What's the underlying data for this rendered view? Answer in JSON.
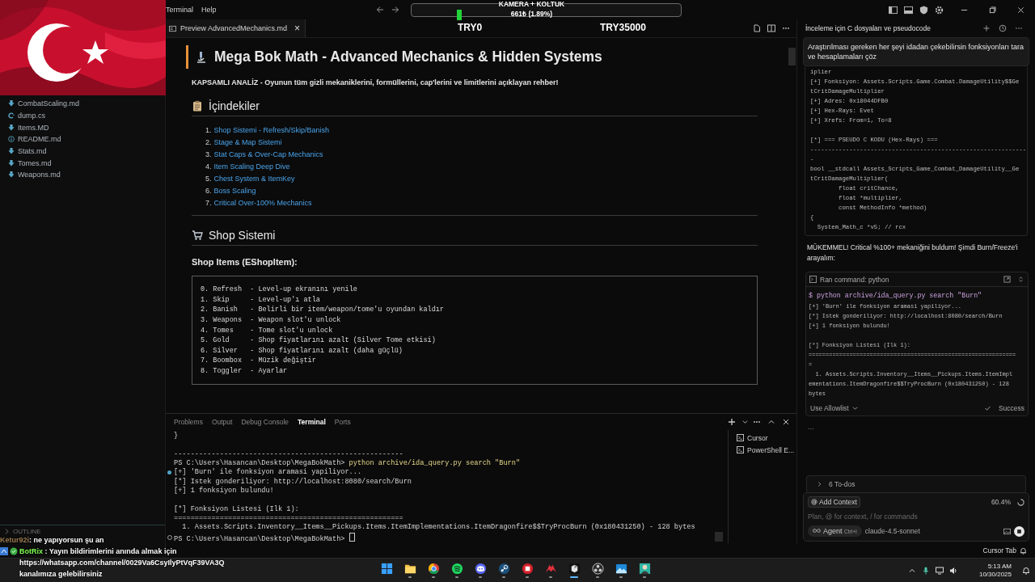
{
  "menu": [
    "Terminal",
    "Help"
  ],
  "stream_goal": {
    "title": "KAMERA + KOLTUK",
    "amount": "661₺ (1.89%)",
    "min_label": "TRY0",
    "max_label": "TRY35000"
  },
  "sidebar": {
    "files": [
      {
        "name": "CombatScaling.md",
        "kind": "markdown"
      },
      {
        "name": "dump.cs",
        "kind": "csharp"
      },
      {
        "name": "Items.MD",
        "kind": "markdown"
      },
      {
        "name": "README.md",
        "kind": "info"
      },
      {
        "name": "Stats.md",
        "kind": "markdown"
      },
      {
        "name": "Tomes.md",
        "kind": "markdown"
      },
      {
        "name": "Weapons.md",
        "kind": "markdown"
      }
    ],
    "outline_label": "OUTLINE"
  },
  "stream_chat": [
    {
      "user": "Ketur92i",
      "message": ": ne yapıyorsun şu an",
      "color": "#9a7a4e",
      "badges": false
    },
    {
      "user": "BotRix",
      "message": " : Yayın bildirimlerini anında almak için https://whatsapp.com/channel/0029Va6CsyIlyPtVqF39VA3Q kanalımıza gelebilirsiniz",
      "color": "#7dff4f",
      "badges": true
    }
  ],
  "editor_tab": {
    "label": "Preview AdvancedMechanics.md",
    "close": "×"
  },
  "doc": {
    "title": "Mega Bok Math - Advanced Mechanics & Hidden Systems",
    "intro": "KAPSAMLI ANALİZ - Oyunun tüm gizli mekaniklerini, formüllerini, cap'lerini ve limitlerini açıklayan rehber!",
    "toc_heading": "İçindekiler",
    "toc": [
      {
        "number": "1.",
        "text": "Shop Sistemi - Refresh/Skip/Banish"
      },
      {
        "number": "2.",
        "text": "Stage & Map Sistemi"
      },
      {
        "number": "3.",
        "text": "Stat Caps & Over-Cap Mechanics"
      },
      {
        "number": "4.",
        "text": "Item Scaling Deep Dive"
      },
      {
        "number": "5.",
        "text": "Chest System & ItemKey"
      },
      {
        "number": "6.",
        "text": "Boss Scaling"
      },
      {
        "number": "7.",
        "text": "Critical Over-100% Mechanics"
      }
    ],
    "shop_heading": "Shop Sistemi",
    "shop_subheading": "Shop Items (EShopItem):",
    "code": [
      "0. Refresh  - Level-up ekranını yenile",
      "1. Skip     - Level-up'ı atla",
      "2. Banish   - Belirli bir item/weapon/tome'u oyundan kaldır",
      "3. Weapons  - Weapon slot'u unlock",
      "4. Tomes    - Tome slot'u unlock",
      "5. Gold     - Shop fiyatlarını azalt (Silver Tome etkisi)",
      "6. Silver   - Shop fiyatlarını azalt (daha güçlü)",
      "7. Boombox  - Müzik değiştir",
      "8. Toggler  - Ayarlar"
    ]
  },
  "terminal": {
    "tabs": [
      {
        "label": "Problems",
        "selected": false
      },
      {
        "label": "Output",
        "selected": false
      },
      {
        "label": "Debug Console",
        "selected": false
      },
      {
        "label": "Terminal",
        "selected": true
      },
      {
        "label": "Ports",
        "selected": false
      }
    ],
    "blocks": [
      [
        {
          "kind": "output",
          "text": "}"
        }
      ],
      [
        {
          "kind": "output",
          "text": "-------------------------------------------------------"
        },
        {
          "kind": "prompt",
          "text": "PS C:\\Users\\Hasancan\\Desktop\\MegaBokMath> ",
          "command": "python archive/ida_query.py search \"Burn\""
        },
        {
          "kind": "output",
          "text": "[+] 'Burn' ile fonksiyon aramasi yapiliyor...",
          "success_mark": true
        },
        {
          "kind": "output",
          "text": "[*] Istek gonderiliyor: http://localhost:8080/search/Burn"
        },
        {
          "kind": "output",
          "text": "[+] 1 fonksiyon bulundu!"
        }
      ],
      [
        {
          "kind": "output",
          "text": "[*] Fonksiyon Listesi (Ilk 1):"
        },
        {
          "kind": "output",
          "text": "======================================================="
        },
        {
          "kind": "output",
          "text": "  1. Assets.Scripts.Inventory__Items__Pickups.Items.ItemImplementations.ItemDragonfire$$TryProcBurn (0x180431250) - 128 bytes"
        },
        {
          "kind": "prompt",
          "text": "PS C:\\Users\\Hasancan\\Desktop\\MegaBokMath> ",
          "pending_mark": true
        }
      ]
    ],
    "sessions": [
      "Cursor",
      "PowerShell E..."
    ]
  },
  "agent": {
    "title": "İnceleme için C dosyaları ve pseudocode",
    "user_message": "Araştırılması gereken her şeyi idadan çekebilirsin fonksiyonları tara ve hesaplamaları çöz",
    "code_blocks": [
      [
        "iplier",
        "[+] Fonksiyon: Assets.Scripts.Game.Combat.DamageUtility$$Ge",
        "tCritDamageMultiplier",
        "[+] Adres: 0x18044DFB0",
        "[+] Hex-Rays: Evet",
        "[+] Xrefs: From=1, To=8"
      ],
      [
        "[*] === PSEUDO C KODU (Hex-Rays) ===",
        "-------------------------------------------------------------",
        "-",
        "bool __stdcall Assets_Scripts_Game_Combat_DamageUtility__Ge",
        "tCritDamageMultiplier(",
        "        float critChance,",
        "        float *multiplier,",
        "        const MethodInfo *method)",
        "{",
        "  System_Math_c *v5; // rcx"
      ]
    ],
    "reply": "MÜKEMMEL! Critical %100+ mekaniğini buldum! Şimdi Burn/Freeze'i arayalım:",
    "command_card": {
      "title": "Ran command: python",
      "command": "$ python archive/ida_query.py search \"Burn\"",
      "output_blocks": [
        [
          "[+] 'Burn' ile fonksiyon aramasi yapiliyor...",
          "[*] Istek gonderiliyor: http://localhost:8080/search/Burn",
          "[+] 1 fonksiyon bulundu!"
        ],
        [
          "[*] Fonksiyon Listesi (Ilk 1):",
          "=============================================================",
          "=",
          "  1. Assets.Scripts.Inventory__Items__Pickups.Items.ItemImpl",
          "ementations.ItemDragonfire$$TryProcBurn (0x180431250) - 128",
          "bytes"
        ]
      ],
      "allowlist": "Use Allowlist",
      "status": "Success"
    },
    "thinking": "...",
    "todos": "6 To-dos",
    "add_context": "Add Context",
    "context_usage": "60.4%",
    "placeholder": "Plan, @ for context, / for commands",
    "mode": "Agent",
    "mode_shortcut": "Ctrl+I",
    "model": "claude-4.5-sonnet"
  },
  "status_bar": {
    "label": "Cursor Tab"
  },
  "taskbar": {
    "apps": [
      {
        "kind": "start",
        "active": false
      },
      {
        "kind": "folder",
        "active": false
      },
      {
        "kind": "chrome",
        "active": false
      },
      {
        "kind": "spotify",
        "active": false
      },
      {
        "kind": "discord",
        "active": false
      },
      {
        "kind": "steam",
        "active": false
      },
      {
        "kind": "red",
        "active": false
      },
      {
        "kind": "msi",
        "active": false
      },
      {
        "kind": "cursor",
        "active": true
      },
      {
        "kind": "obs",
        "active": false
      },
      {
        "kind": "photos",
        "active": false
      },
      {
        "kind": "avatar",
        "active": false
      }
    ],
    "time": "5:13 AM",
    "date": "10/30/2025"
  }
}
